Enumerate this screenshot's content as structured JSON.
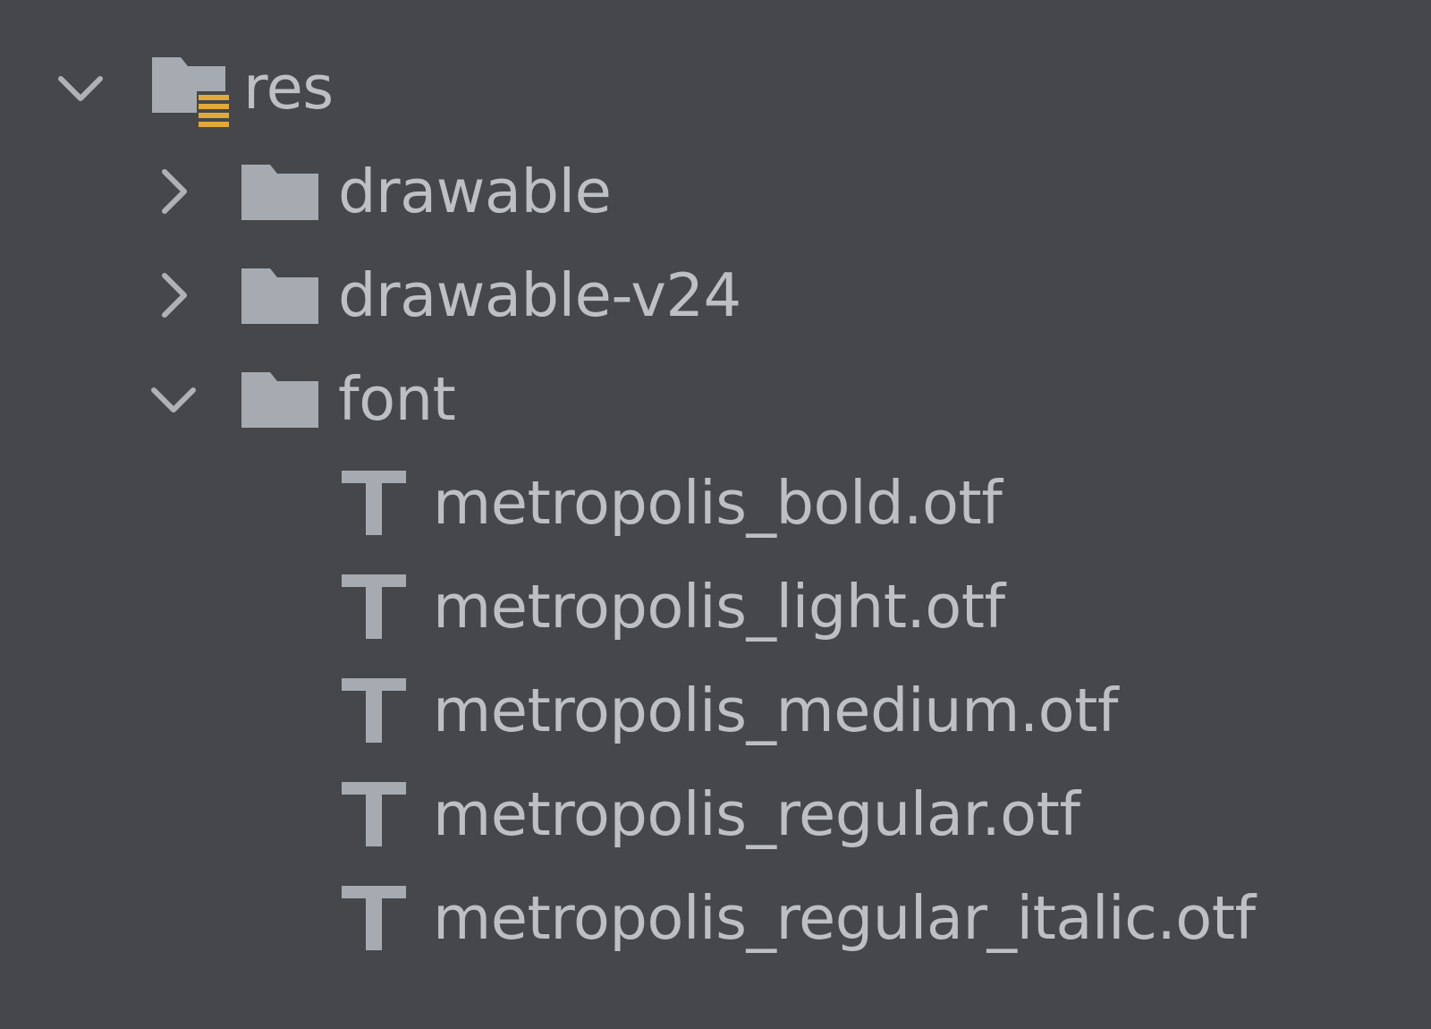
{
  "project_tree": {
    "res": {
      "label": "res",
      "expanded": true,
      "icon": "resource-folder-icon"
    },
    "folders": [
      {
        "label": "drawable",
        "expanded": false,
        "icon": "folder-icon"
      },
      {
        "label": "drawable-v24",
        "expanded": false,
        "icon": "folder-icon"
      },
      {
        "label": "font",
        "expanded": true,
        "icon": "folder-icon"
      }
    ],
    "font_files": [
      {
        "label": "metropolis_bold.otf",
        "icon": "font-file-icon"
      },
      {
        "label": "metropolis_light.otf",
        "icon": "font-file-icon"
      },
      {
        "label": "metropolis_medium.otf",
        "icon": "font-file-icon"
      },
      {
        "label": "metropolis_regular.otf",
        "icon": "font-file-icon"
      },
      {
        "label": "metropolis_regular_italic.otf",
        "icon": "font-file-icon"
      }
    ]
  },
  "colors": {
    "background": "#45474a",
    "text": "#bcbfc3",
    "folder": "#a6abb2",
    "resource_badge": "#e0a93a"
  }
}
